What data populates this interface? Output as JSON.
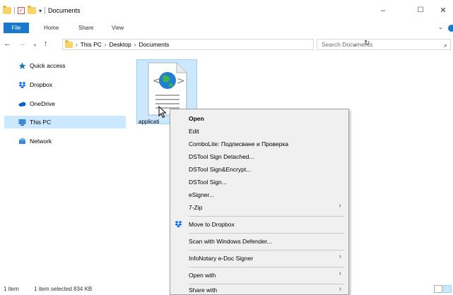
{
  "window": {
    "title": "Documents",
    "qa_dropdown": "▾",
    "min_glyph": "–",
    "max_glyph": "☐",
    "close_glyph": "✕"
  },
  "ribbon": {
    "tabs": [
      "File",
      "Home",
      "Share",
      "View"
    ],
    "expand_glyph": "⌄"
  },
  "nav": {
    "back": "←",
    "forward": "→",
    "recent": "⌄",
    "up": "↑",
    "breadcrumbs": [
      "This PC",
      "Desktop",
      "Documents"
    ],
    "crumb_sep": "›",
    "dropdown": "⌄",
    "refresh": "↻",
    "search_placeholder": "Search Documents",
    "search_glyph": "⌕"
  },
  "sidebar": {
    "items": [
      {
        "label": "Quick access",
        "icon": "star-icon",
        "color": "#1e73be"
      },
      {
        "label": "Dropbox",
        "icon": "dropbox-icon",
        "color": "#0061fe"
      },
      {
        "label": "OneDrive",
        "icon": "cloud-icon",
        "color": "#0a64c8"
      },
      {
        "label": "This PC",
        "icon": "computer-icon",
        "color": "#3a8ad8",
        "selected": true
      },
      {
        "label": "Network",
        "icon": "network-icon",
        "color": "#3a8ad8"
      }
    ]
  },
  "files": [
    {
      "label": "applicati",
      "icon": "html-document-icon"
    }
  ],
  "status": {
    "items": "1 item",
    "selected": "1 item selected  834 KB"
  },
  "context_menu": {
    "items": [
      {
        "label": "Open",
        "bold": true
      },
      {
        "label": "Edit"
      },
      {
        "label": "ComboLite: Подписване и Проверка"
      },
      {
        "label": "DSTool Sign Detached..."
      },
      {
        "label": "DSTool Sign&Encrypt..."
      },
      {
        "label": "DSTool Sign..."
      },
      {
        "label": "eSigner..."
      },
      {
        "label": "7-Zip",
        "submenu": true
      },
      {
        "label": "Move to Dropbox",
        "icon": "dropbox-icon"
      },
      {
        "label": "Scan with Windows Defender..."
      },
      {
        "label": "InfoNotary e-Doc Signer",
        "submenu": true
      },
      {
        "label": "Open with",
        "submenu": true
      },
      {
        "label": "Share with",
        "submenu": true
      }
    ],
    "arrow_glyph": "›"
  },
  "colors": {
    "accent": "#1979ca",
    "selection": "#cce8ff",
    "menu_bg": "#f0f0f0"
  }
}
